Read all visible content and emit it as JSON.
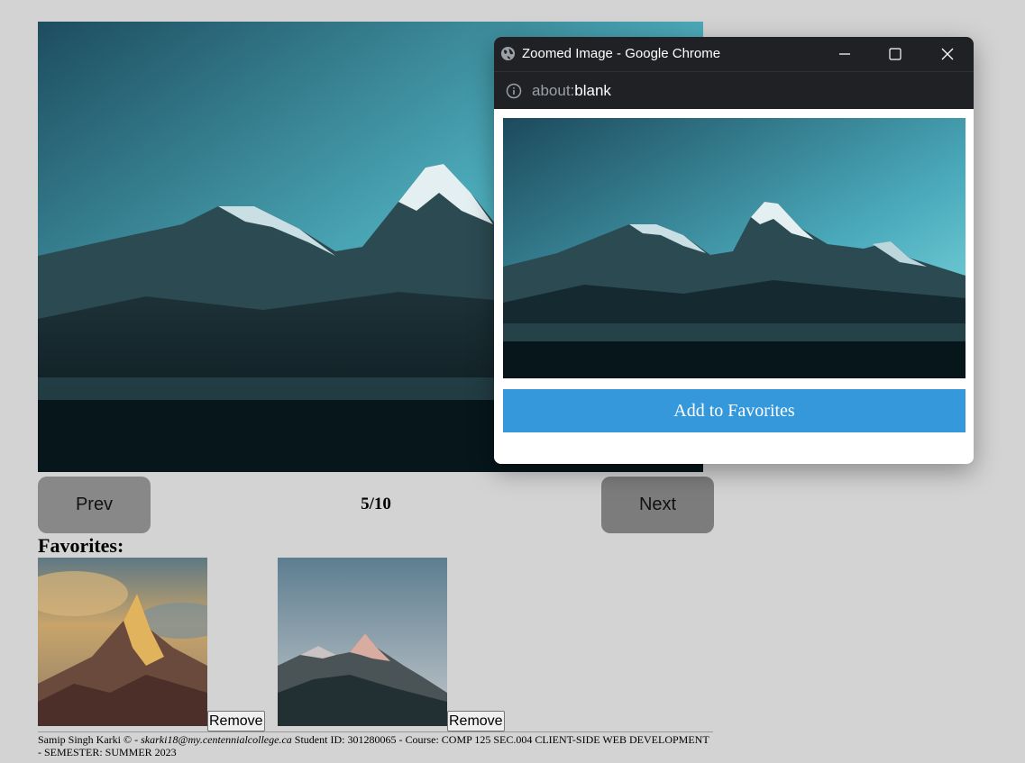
{
  "gallery": {
    "main_image_alt": "mountain-at-night",
    "prev_label": "Prev",
    "next_label": "Next",
    "counter": "5/10"
  },
  "favorites": {
    "title": "Favorites:",
    "items": [
      {
        "image": "golden-peak-clouds",
        "remove_label": "Remove"
      },
      {
        "image": "pink-peak-dusk",
        "remove_label": "Remove"
      }
    ]
  },
  "footer": {
    "author": "Samip Singh Karki © - ",
    "email": "skarki18@my.centennialcollege.ca",
    "rest": " Student ID: 301280065 - Course: COMP 125 SEC.004 CLIENT-SIDE WEB DEVELOPMENT - SEMESTER: SUMMER 2023"
  },
  "popup": {
    "window_title": "Zoomed Image - Google Chrome",
    "url_scheme": "about:",
    "url_host": "blank",
    "add_favorites_label": "Add to Favorites",
    "icons": {
      "site": "globe-icon",
      "info": "info-icon",
      "minimize": "minimize-icon",
      "maximize": "maximize-icon",
      "close": "close-icon"
    }
  },
  "colors": {
    "page_bg": "#d3d3d3",
    "button_gray": "#888888",
    "chrome_dark": "#202124",
    "accent_blue": "#3498db"
  }
}
